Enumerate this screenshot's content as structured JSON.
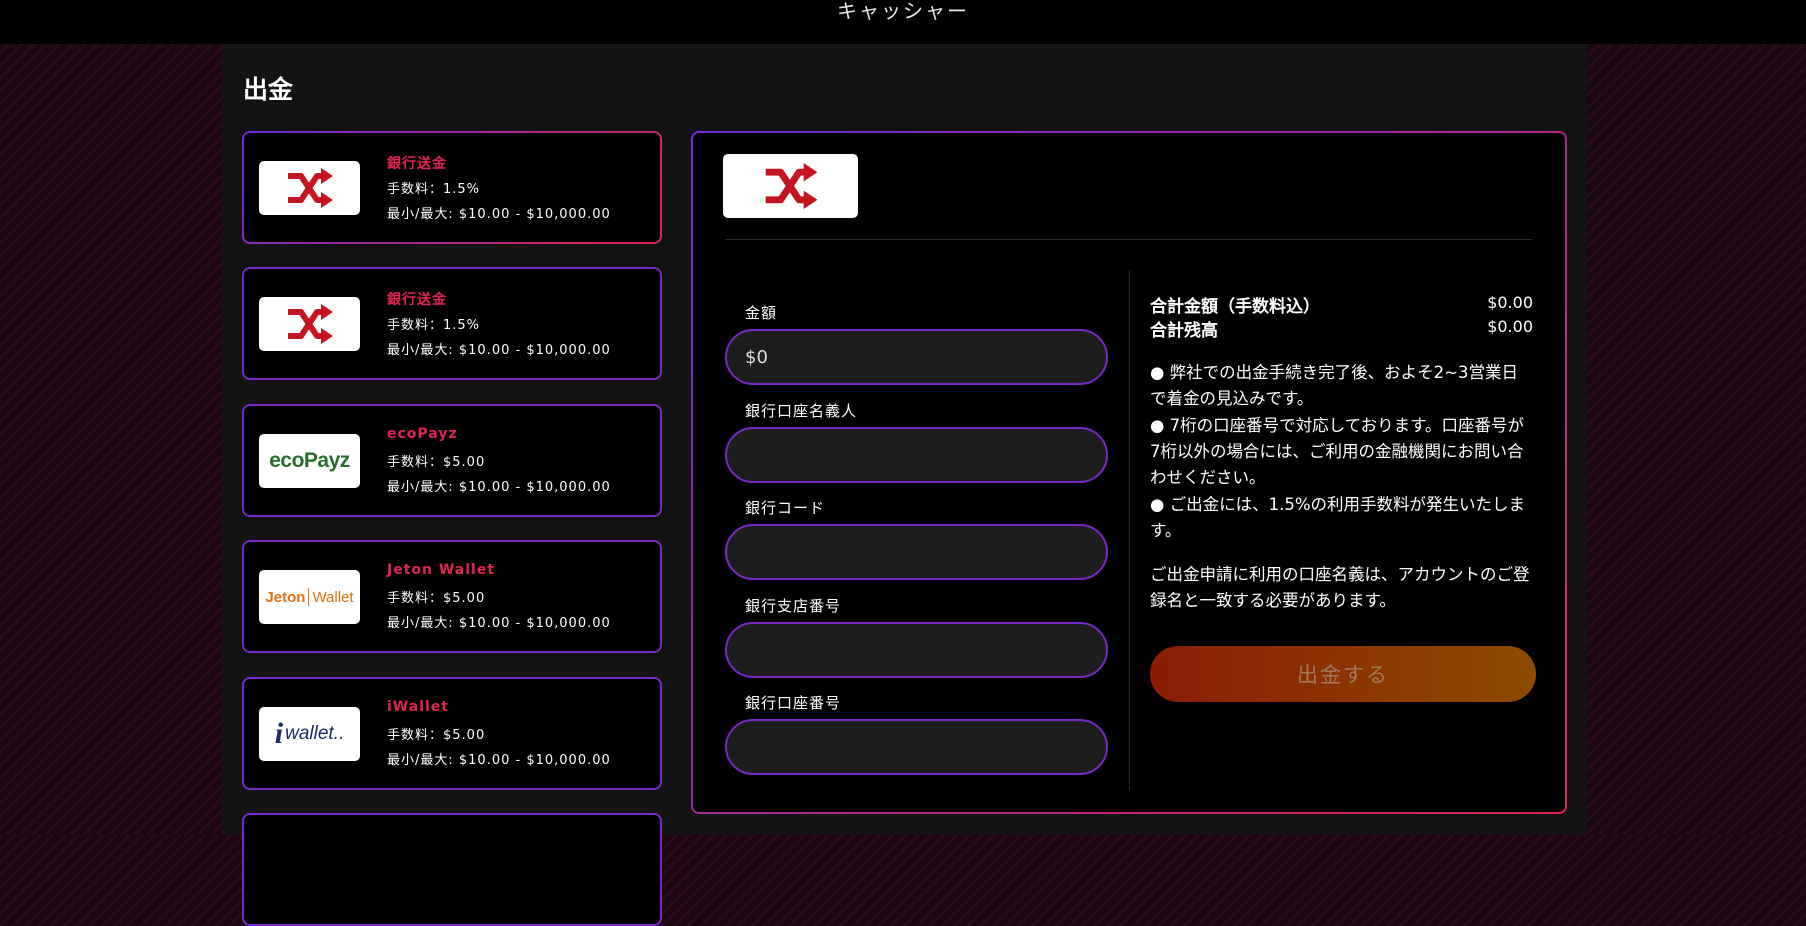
{
  "header": {
    "title": "キャッシャー"
  },
  "page": {
    "title": "出金"
  },
  "methods": [
    {
      "name": "銀行送金",
      "fee": "手数料：1.5%",
      "range": "最小/最大: $10.00 - $10,000.00",
      "logo": "shuffle-icon"
    },
    {
      "name": "銀行送金",
      "fee": "手数料：1.5%",
      "range": "最小/最大: $10.00 - $10,000.00",
      "logo": "shuffle-icon"
    },
    {
      "name": "ecoPayz",
      "fee": "手数料：$5.00",
      "range": "最小/最大: $10.00 - $10,000.00",
      "logo": "ecopayz-logo"
    },
    {
      "name": "Jeton Wallet",
      "fee": "手数料：$5.00",
      "range": "最小/最大: $10.00 - $10,000.00",
      "logo": "jeton-wallet-logo"
    },
    {
      "name": "iWallet",
      "fee": "手数料：$5.00",
      "range": "最小/最大: $10.00 - $10,000.00",
      "logo": "iwallet-logo"
    }
  ],
  "logos": {
    "ecopayz": "ecoPayz",
    "jeton_left": "Jeton",
    "jeton_right": "Wallet",
    "iwallet": "wallet.."
  },
  "form": {
    "amount_label": "金額",
    "amount_placeholder": "$0",
    "holder_label": "銀行口座名義人",
    "bank_code_label": "銀行コード",
    "branch_label": "銀行支店番号",
    "account_label": "銀行口座番号"
  },
  "summary": {
    "total_label": "合計金額（手数料込）",
    "total_value": "$0.00",
    "balance_label": "合計残高",
    "balance_value": "$0.00"
  },
  "notes": [
    "● 弊社での出金手続き完了後、およそ2~3営業日で着金の見込みです。",
    "● 7桁の口座番号で対応しております。口座番号が7桁以外の場合には、ご利用の金融機関にお問い合わせください。",
    "● ご出金には、1.5%の利用手数料が発生いたします。"
  ],
  "account_note": "ご出金申請に利用の口座名義は、アカウントのご登録名と一致する必要があります。",
  "submit_label": "出金する",
  "colors": {
    "accent_red": "#e02452",
    "border_purple": "#7a27c8",
    "button_start": "#8a1c04",
    "button_end": "#8d4c02"
  }
}
